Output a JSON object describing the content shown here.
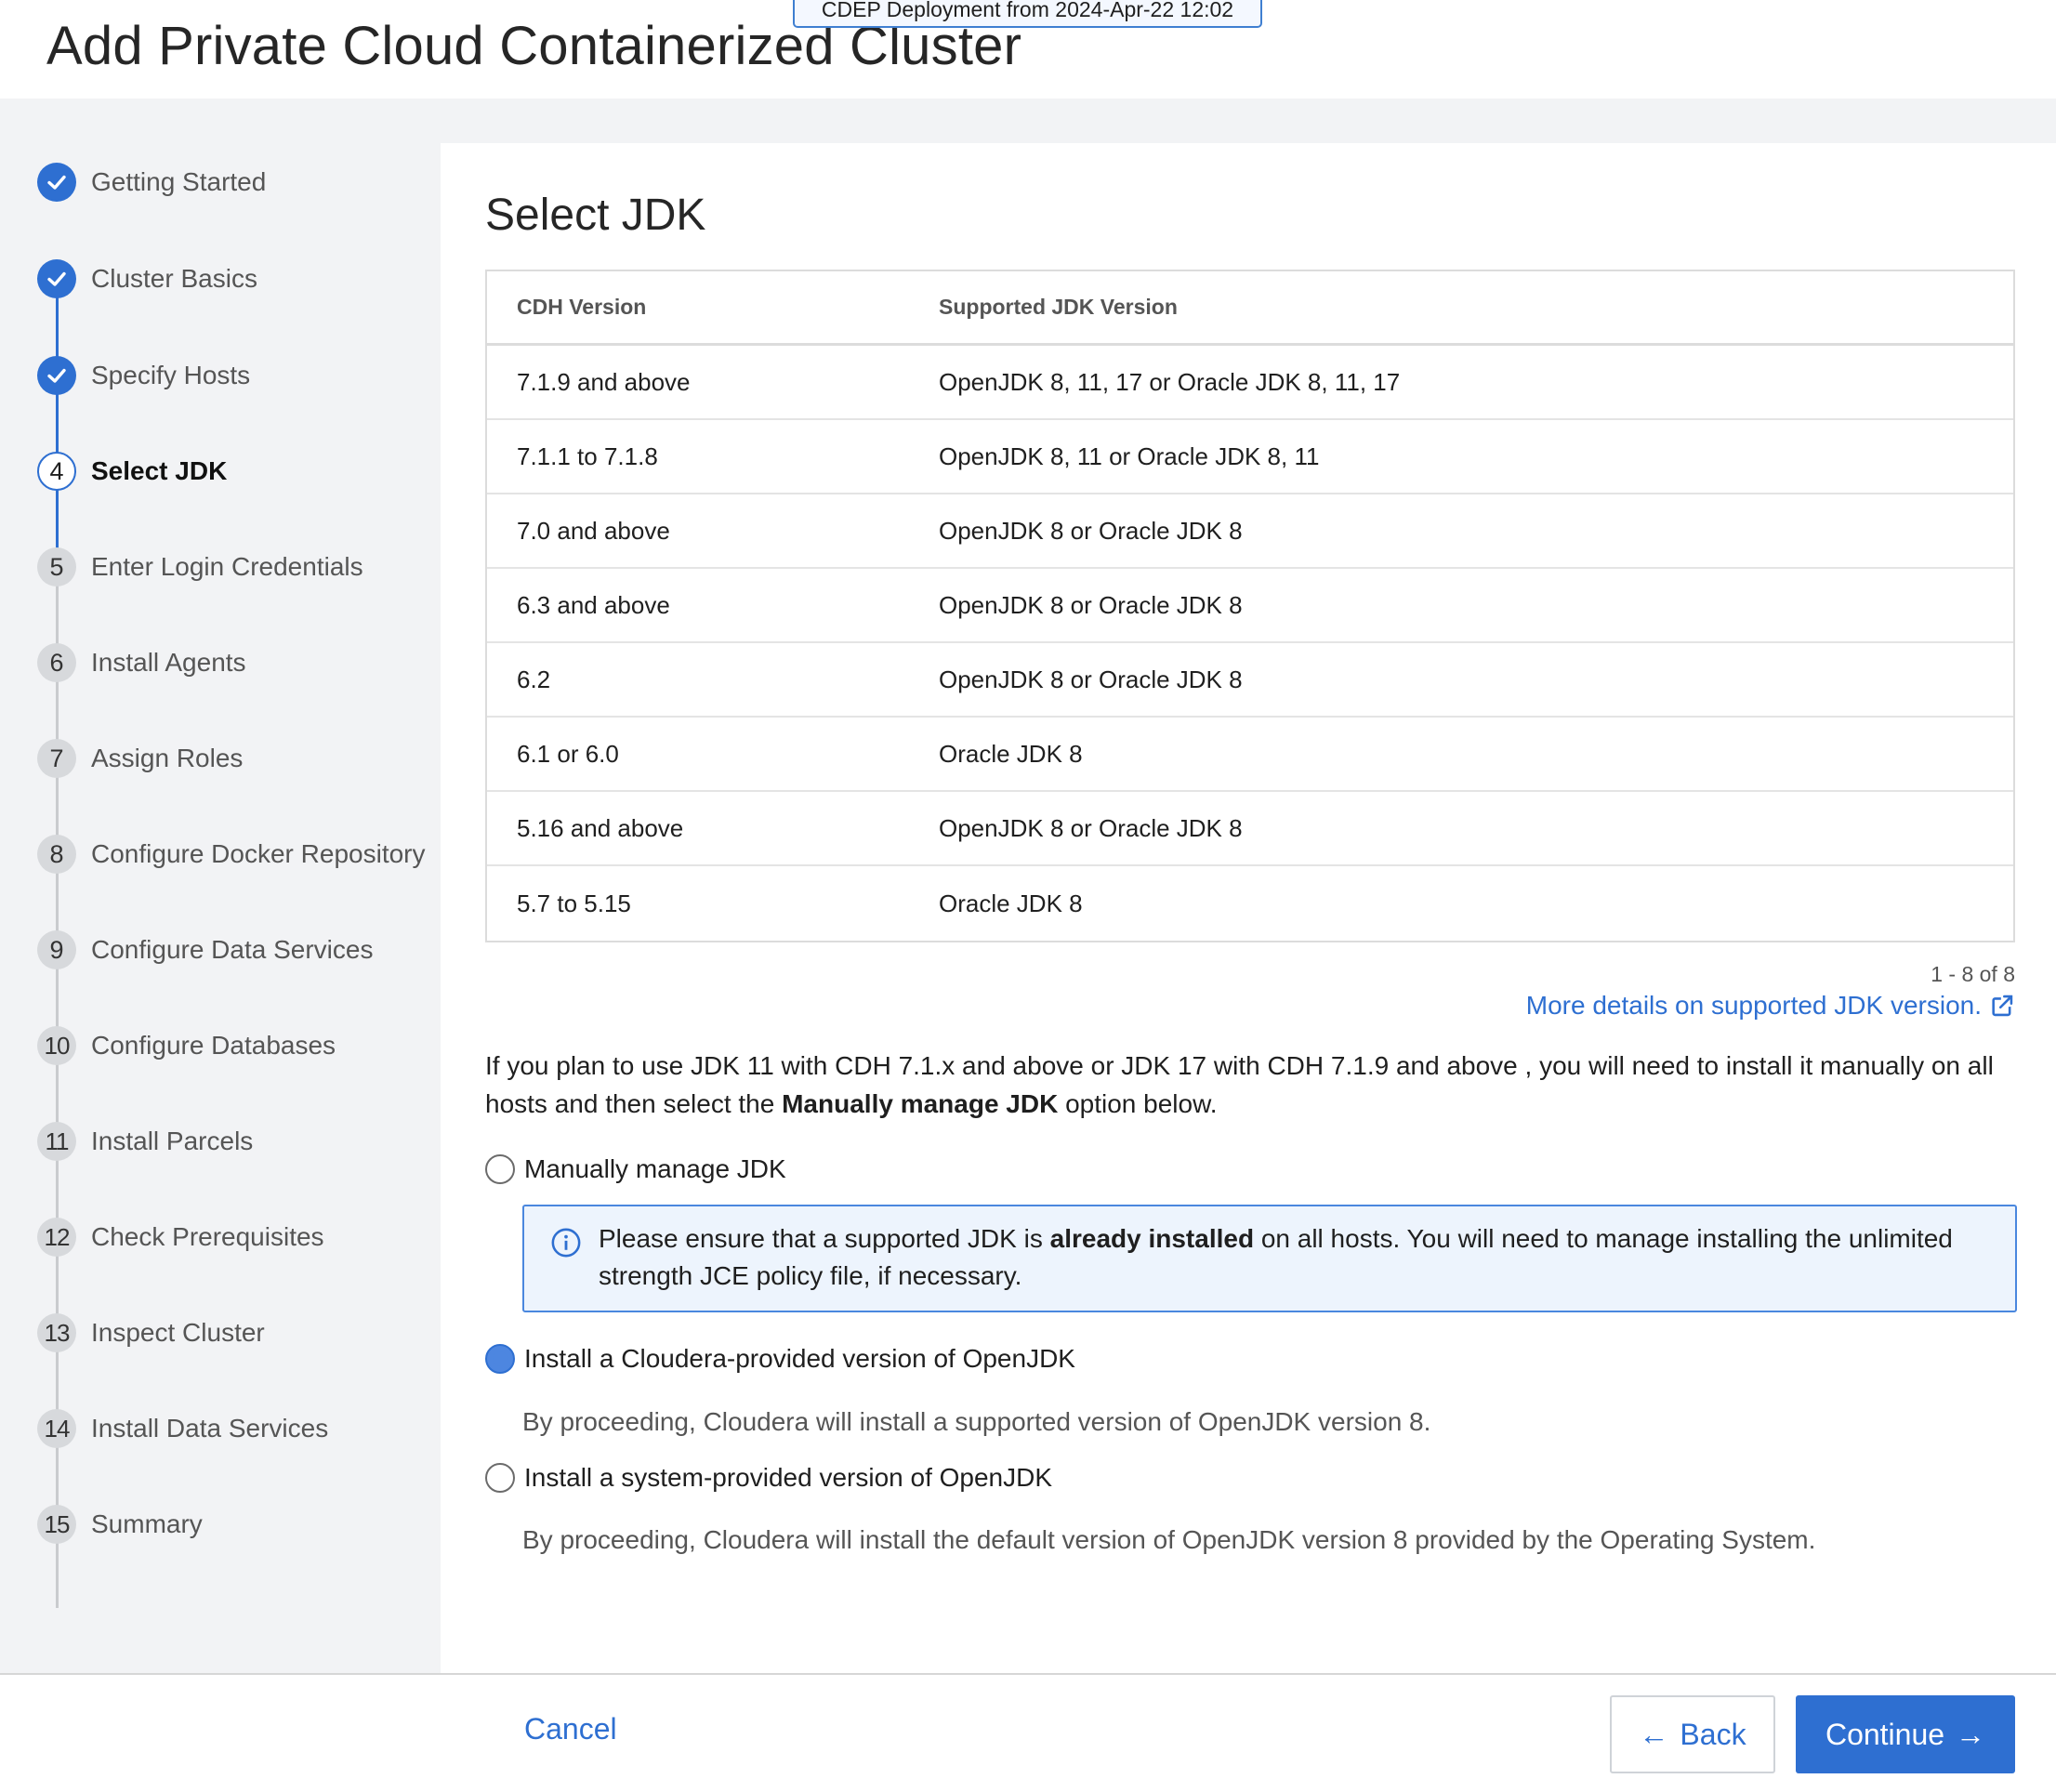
{
  "header": {
    "title": "Add Private Cloud Containerized Cluster",
    "deployment_badge": "CDEP Deployment from 2024-Apr-22 12:02"
  },
  "sidebar": {
    "steps": [
      {
        "number": "1",
        "label": "Getting Started",
        "state": "done"
      },
      {
        "number": "2",
        "label": "Cluster Basics",
        "state": "done"
      },
      {
        "number": "3",
        "label": "Specify Hosts",
        "state": "done"
      },
      {
        "number": "4",
        "label": "Select JDK",
        "state": "active"
      },
      {
        "number": "5",
        "label": "Enter Login Credentials",
        "state": "pending"
      },
      {
        "number": "6",
        "label": "Install Agents",
        "state": "pending"
      },
      {
        "number": "7",
        "label": "Assign Roles",
        "state": "pending"
      },
      {
        "number": "8",
        "label": "Configure Docker Repository",
        "state": "pending"
      },
      {
        "number": "9",
        "label": "Configure Data Services",
        "state": "pending"
      },
      {
        "number": "10",
        "label": "Configure Databases",
        "state": "pending"
      },
      {
        "number": "11",
        "label": "Install Parcels",
        "state": "pending"
      },
      {
        "number": "12",
        "label": "Check Prerequisites",
        "state": "pending"
      },
      {
        "number": "13",
        "label": "Inspect Cluster",
        "state": "pending"
      },
      {
        "number": "14",
        "label": "Install Data Services",
        "state": "pending"
      },
      {
        "number": "15",
        "label": "Summary",
        "state": "pending"
      }
    ]
  },
  "main": {
    "section_title": "Select JDK",
    "table": {
      "headers": [
        "CDH Version",
        "Supported JDK Version"
      ],
      "rows": [
        [
          "7.1.9 and above",
          "OpenJDK 8, 11, 17 or Oracle JDK 8, 11, 17"
        ],
        [
          "7.1.1 to 7.1.8",
          "OpenJDK 8, 11 or Oracle JDK 8, 11"
        ],
        [
          "7.0 and above",
          "OpenJDK 8 or Oracle JDK 8"
        ],
        [
          "6.3 and above",
          "OpenJDK 8 or Oracle JDK 8"
        ],
        [
          "6.2",
          "OpenJDK 8 or Oracle JDK 8"
        ],
        [
          "6.1 or 6.0",
          "Oracle JDK 8"
        ],
        [
          "5.16 and above",
          "OpenJDK 8 or Oracle JDK 8"
        ],
        [
          "5.7 to 5.15",
          "Oracle JDK 8"
        ]
      ]
    },
    "pager_text": "1 - 8 of 8",
    "more_details_link": "More details on supported JDK version.",
    "info_text_1": "If you plan to use JDK 11 with CDH 7.1.x and above or JDK 17 with CDH 7.1.9 and above , you will need to install it manually on all hosts and then select the ",
    "info_text_bold": "Manually manage JDK",
    "info_text_2": " option below.",
    "options": {
      "manual": {
        "label": "Manually manage JDK",
        "selected": false,
        "alert_text_1": "Please ensure that a supported JDK is ",
        "alert_text_bold": "already installed",
        "alert_text_2": " on all hosts. You will need to manage installing the unlimited strength JCE policy file, if necessary."
      },
      "cloudera": {
        "label": "Install a Cloudera-provided version of OpenJDK",
        "selected": true,
        "description": "By proceeding, Cloudera will install a supported version of OpenJDK version 8."
      },
      "system": {
        "label": "Install a system-provided version of OpenJDK",
        "selected": false,
        "description": "By proceeding, Cloudera will install the default version of OpenJDK version 8 provided by the Operating System."
      }
    }
  },
  "footer": {
    "cancel_label": "Cancel",
    "back_label": "Back",
    "continue_label": "Continue"
  },
  "colors": {
    "accent": "#2e6fd1",
    "alert_border": "#4a87de",
    "alert_background": "#edf4fd",
    "sidebar_background": "#f2f3f5"
  },
  "icons": {
    "step_done": "check-circle-icon",
    "alert": "info-circle-icon",
    "link": "external-link-icon",
    "back": "arrow-left-icon",
    "continue": "arrow-right-icon"
  }
}
